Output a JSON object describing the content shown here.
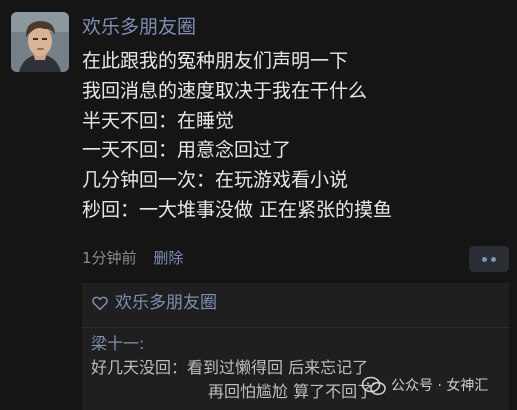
{
  "post": {
    "username": "欢乐多朋友圈",
    "lines": [
      "在此跟我的冤种朋友们声明一下",
      "我回消息的速度取决于我在干什么",
      "半天不回：在睡觉",
      "一天不回：用意念回过了",
      "几分钟回一次：在玩游戏看小说",
      "秒回：一大堆事没做 正在紧张的摸鱼"
    ],
    "time": "1分钟前",
    "delete_label": "删除"
  },
  "likes": {
    "names": "欢乐多朋友圈"
  },
  "comment": {
    "author": "梁十一:",
    "line1": "好几天没回：看到过懒得回 后来忘记了",
    "line2": "再回怕尴尬 算了不回了"
  },
  "watermark": {
    "text": "公众号 · 女神汇"
  },
  "icons": {
    "like": "heart-outline-icon",
    "more": "more-dots-icon",
    "watermark": "wechat-logo-icon"
  },
  "colors": {
    "background": "#151515",
    "link": "#7d8fb3",
    "text": "#e6e6e6",
    "secondary": "#8a8a8a",
    "panel": "#1f1f1f"
  }
}
